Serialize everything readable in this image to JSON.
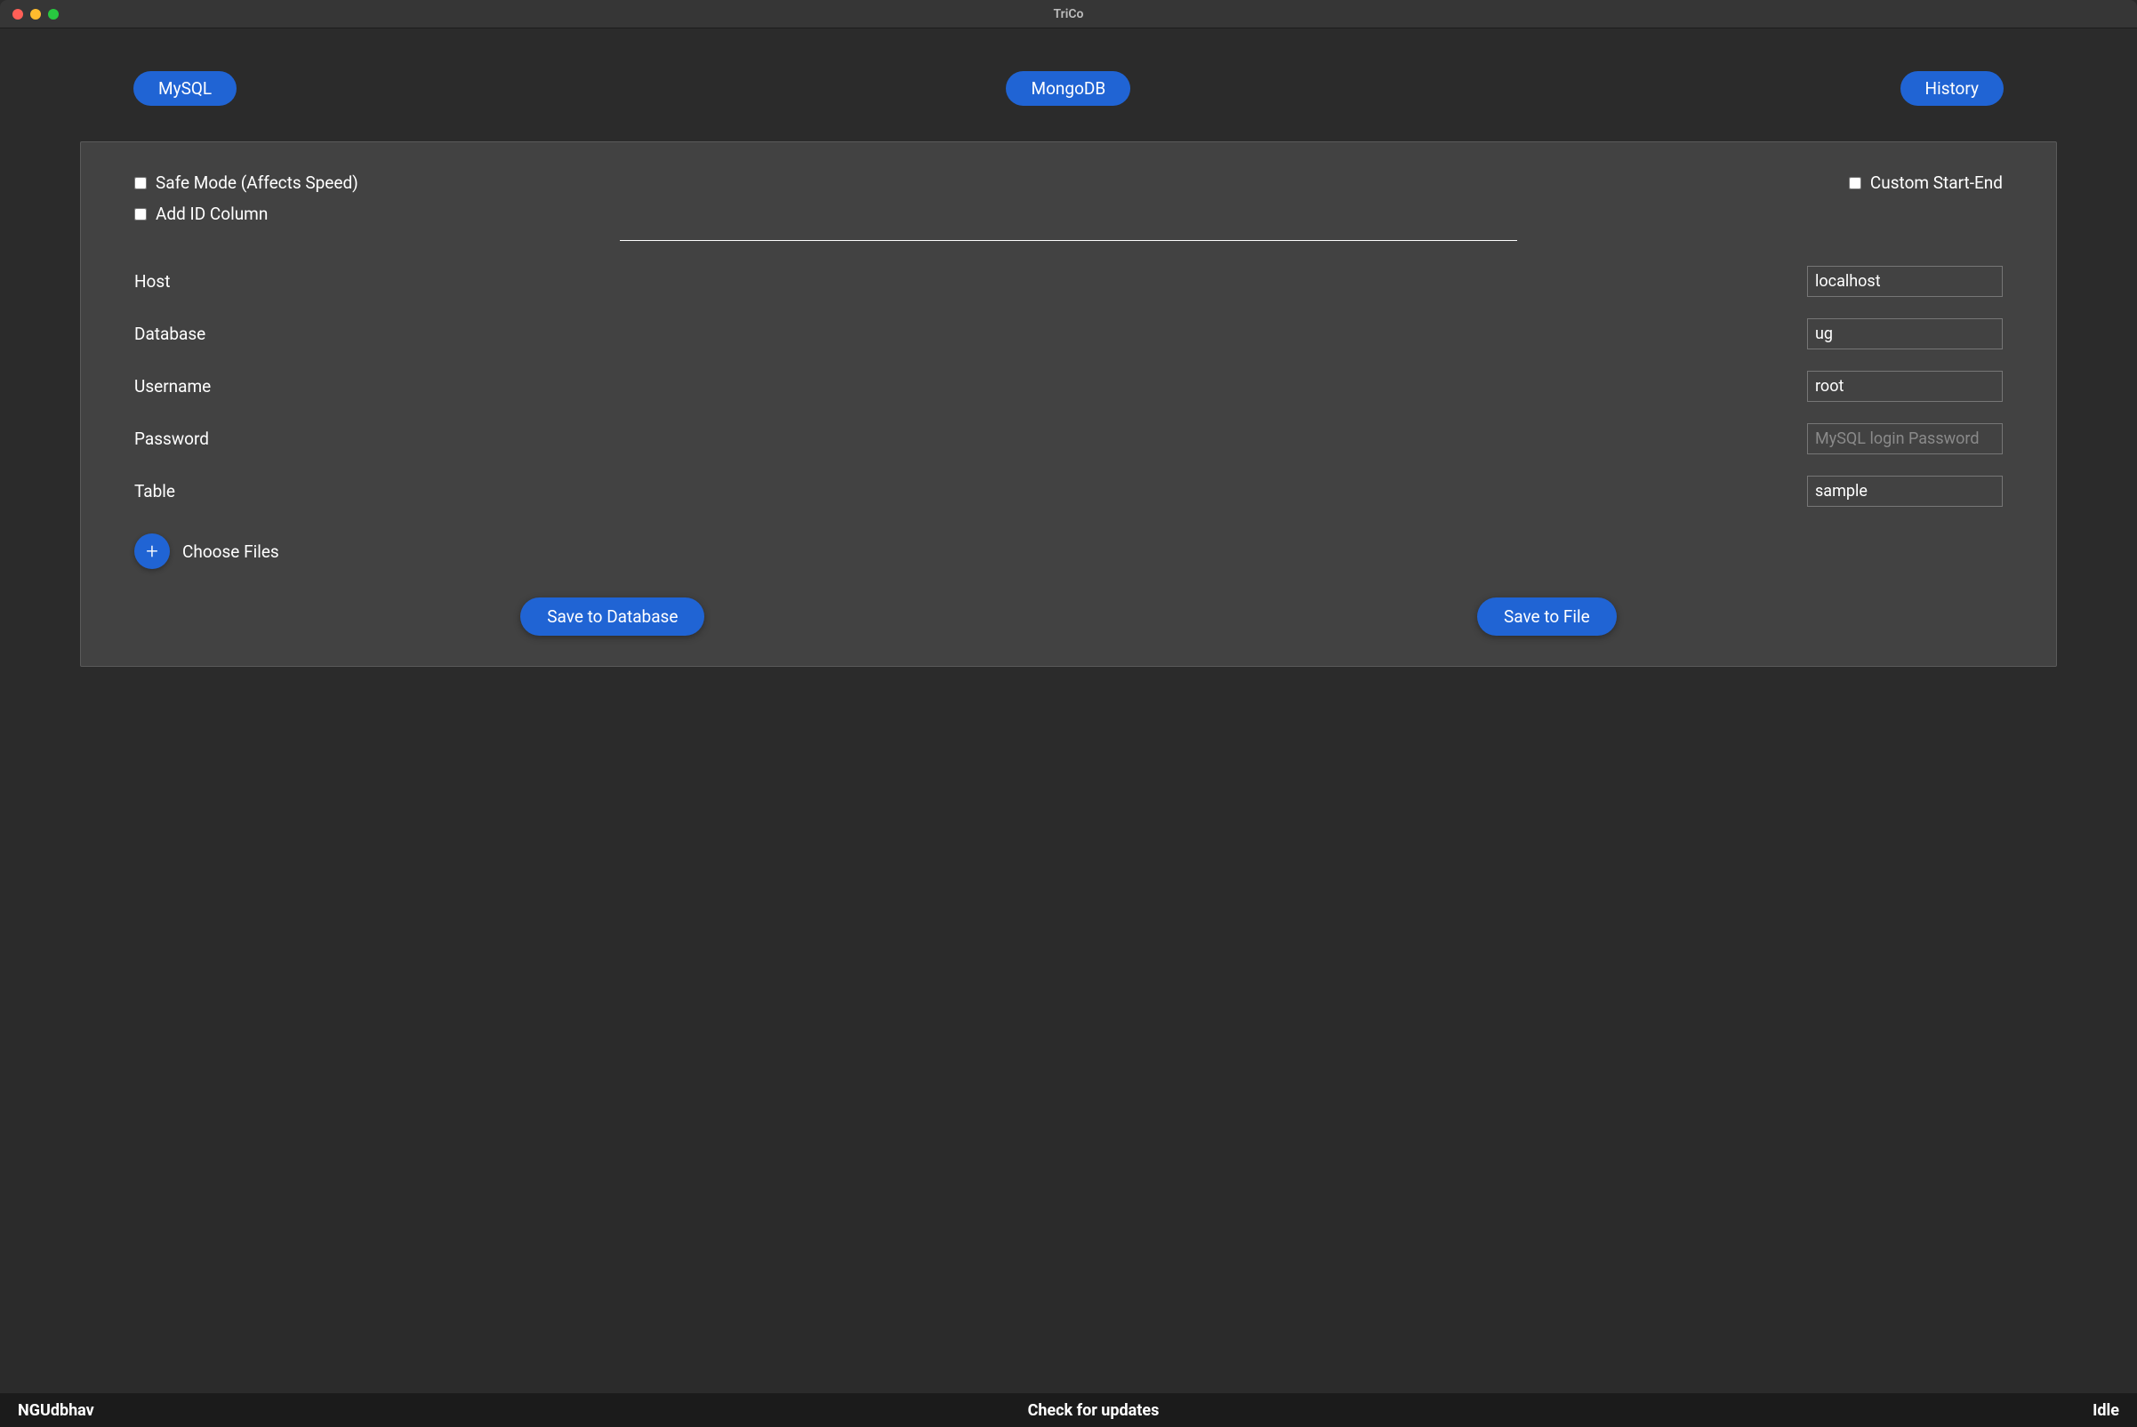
{
  "window": {
    "title": "TriCo"
  },
  "tabs": {
    "mysql": "MySQL",
    "mongodb": "MongoDB",
    "history": "History"
  },
  "checkboxes": {
    "safe_mode": "Safe Mode (Affects Speed)",
    "add_id": "Add ID Column",
    "custom_range": "Custom Start-End"
  },
  "form": {
    "host": {
      "label": "Host",
      "value": "localhost"
    },
    "database": {
      "label": "Database",
      "value": "ug"
    },
    "username": {
      "label": "Username",
      "value": "root"
    },
    "password": {
      "label": "Password",
      "value": "",
      "placeholder": "MySQL login Password"
    },
    "table": {
      "label": "Table",
      "value": "sample"
    }
  },
  "choose_files": "Choose Files",
  "actions": {
    "save_db": "Save to Database",
    "save_file": "Save to File"
  },
  "footer": {
    "left": "NGUdbhav",
    "center": "Check for updates",
    "right": "Idle"
  }
}
